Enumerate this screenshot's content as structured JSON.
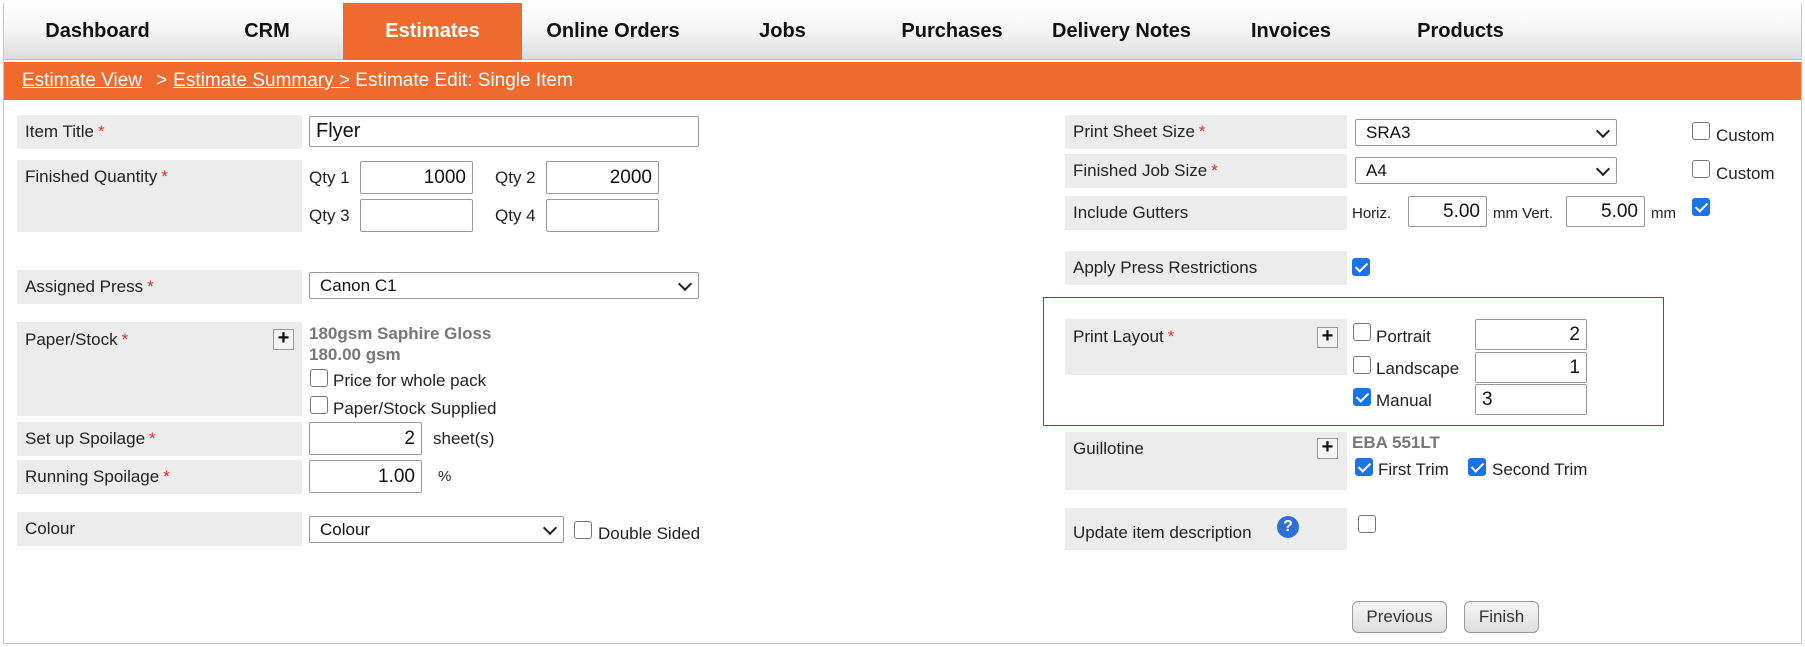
{
  "nav": {
    "items": [
      "Dashboard",
      "CRM",
      "Estimates",
      "Online Orders",
      "Jobs",
      "Purchases",
      "Delivery Notes",
      "Invoices",
      "Products"
    ],
    "active": "Estimates"
  },
  "breadcrumb": {
    "link1": "Estimate View",
    "sep1": ">",
    "link2": "Estimate Summary >",
    "current": "Estimate Edit: Single Item"
  },
  "form": {
    "item_title": {
      "label": "Item Title",
      "value": "Flyer"
    },
    "finished_quantity": {
      "label": "Finished Quantity",
      "qty1_label": "Qty 1",
      "qty1": "1000",
      "qty2_label": "Qty 2",
      "qty2": "2000",
      "qty3_label": "Qty 3",
      "qty3": "",
      "qty4_label": "Qty 4",
      "qty4": ""
    },
    "assigned_press": {
      "label": "Assigned Press",
      "value": "Canon C1"
    },
    "paper_stock": {
      "label": "Paper/Stock",
      "name": "180gsm Saphire Gloss",
      "weight": "180.00 gsm",
      "price_whole_pack": "Price for whole pack",
      "supplied": "Paper/Stock Supplied"
    },
    "setup_spoilage": {
      "label": "Set up Spoilage",
      "value": "2",
      "unit": "sheet(s)"
    },
    "running_spoilage": {
      "label": "Running Spoilage",
      "value": "1.00",
      "unit": "%"
    },
    "colour": {
      "label": "Colour",
      "value": "Colour",
      "double_sided": "Double Sided"
    },
    "print_sheet_size": {
      "label": "Print Sheet Size",
      "value": "SRA3",
      "custom": "Custom"
    },
    "finished_job_size": {
      "label": "Finished Job Size",
      "value": "A4",
      "custom": "Custom"
    },
    "include_gutters": {
      "label": "Include Gutters",
      "horiz_label": "Horiz.",
      "horiz": "5.00",
      "mid_label": "mm Vert.",
      "vert": "5.00",
      "end_label": "mm",
      "checked": true
    },
    "apply_press_restrictions": {
      "label": "Apply Press Restrictions",
      "checked": true
    },
    "print_layout": {
      "label": "Print Layout",
      "portrait": "Portrait",
      "portrait_value": "2",
      "landscape": "Landscape",
      "landscape_value": "1",
      "manual": "Manual",
      "manual_value": "3"
    },
    "guillotine": {
      "label": "Guillotine",
      "name": "EBA 551LT",
      "first_trim": "First Trim",
      "second_trim": "Second Trim"
    },
    "update_description": {
      "label": "Update item description",
      "help": "?"
    },
    "required_mark": "*"
  },
  "buttons": {
    "previous": "Previous",
    "finish": "Finish"
  },
  "colors": {
    "accent": "#ef6a2f",
    "label_bg": "#ececec",
    "required": "#e1302b",
    "checkbox": "#1a73e8",
    "highlight_border": "#c0272d"
  }
}
